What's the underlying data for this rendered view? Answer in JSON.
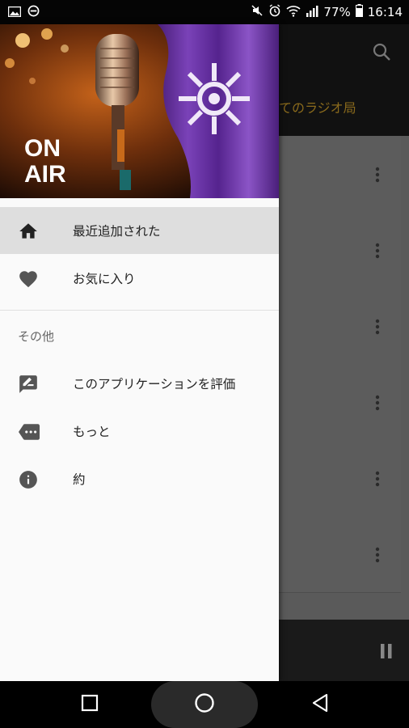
{
  "status_bar": {
    "battery": "77%",
    "time": "16:14",
    "left_icons": [
      "image-icon",
      "minus-circle-icon"
    ],
    "right_icons": [
      "mute-icon",
      "alarm-icon",
      "wifi-icon",
      "signal-icon",
      "battery-icon"
    ]
  },
  "background_app": {
    "tab_label": "てのラジオ局",
    "row_count": 6
  },
  "drawer": {
    "header_text": [
      "ON",
      "AIR"
    ],
    "items": [
      {
        "label": "最近追加された",
        "icon": "home-icon",
        "active": true
      },
      {
        "label": "お気に入り",
        "icon": "heart-icon",
        "active": false
      }
    ],
    "section_label": "その他",
    "other_items": [
      {
        "label": "このアプリケーションを評価",
        "icon": "rate-review-icon"
      },
      {
        "label": "もっと",
        "icon": "more-label-icon"
      },
      {
        "label": "約",
        "icon": "info-icon"
      }
    ]
  },
  "colors": {
    "drawer_bg": "#fafafa",
    "active_item_bg": "#dedede",
    "tab_label_color": "#8a6a1c",
    "icon_color": "#444444"
  },
  "nav_bar": {
    "buttons": [
      "recent-apps-icon",
      "home-circle-icon",
      "back-icon"
    ]
  }
}
